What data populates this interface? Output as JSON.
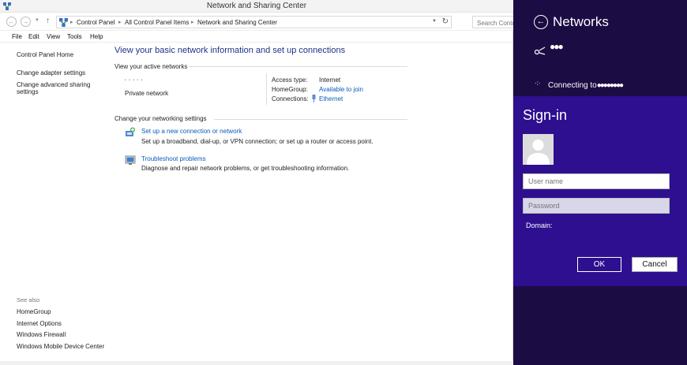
{
  "window": {
    "title": "Network and Sharing Center"
  },
  "address_bar": {
    "crumbs": [
      "Control Panel",
      "All Control Panel Items",
      "Network and Sharing Center"
    ],
    "search_placeholder": "Search Contr"
  },
  "menu": [
    "File",
    "Edit",
    "View",
    "Tools",
    "Help"
  ],
  "left_pane": {
    "links": [
      "Control Panel Home",
      "Change adapter settings",
      "Change advanced sharing",
      "settings"
    ],
    "see_also_label": "See also",
    "see_also": [
      "HomeGroup",
      "Internet Options",
      "Windows Firewall",
      "Windows Mobile Device Center"
    ]
  },
  "main": {
    "heading": "View your basic network information and set up connections",
    "active_networks_label": "View your active networks",
    "network_type": "Private network",
    "access_type_label": "Access type:",
    "access_type_value": "Internet",
    "homegroup_label": "HomeGroup:",
    "homegroup_value": "Available to join",
    "connections_label": "Connections:",
    "connections_value": "Ethernet",
    "change_settings_label": "Change your networking settings",
    "tasks": [
      {
        "link": "Set up a new connection or network",
        "desc": "Set up a broadband, dial-up, or VPN connection; or set up a router or access point."
      },
      {
        "link": "Troubleshoot problems",
        "desc": "Diagnose and repair network problems, or get troubleshooting information."
      }
    ]
  },
  "networks_panel": {
    "title": "Networks",
    "connecting_text": "Connecting to"
  },
  "signin": {
    "title": "Sign-in",
    "username_placeholder": "User name",
    "password_placeholder": "Password",
    "domain_label": "Domain:",
    "ok_label": "OK",
    "cancel_label": "Cancel"
  },
  "colors": {
    "charm_bg": "#1c0c44",
    "signin_bg": "#2d0f8f",
    "link_blue": "#0a5cb8",
    "heading_blue": "#1e3287"
  },
  "icons": [
    "network-center-icon",
    "back-arrow-icon",
    "forward-arrow-icon",
    "up-arrow-icon",
    "refresh-icon",
    "wifi-icon",
    "spinner-icon",
    "user-avatar-icon",
    "ethernet-icon",
    "new-connection-icon",
    "troubleshoot-icon"
  ]
}
